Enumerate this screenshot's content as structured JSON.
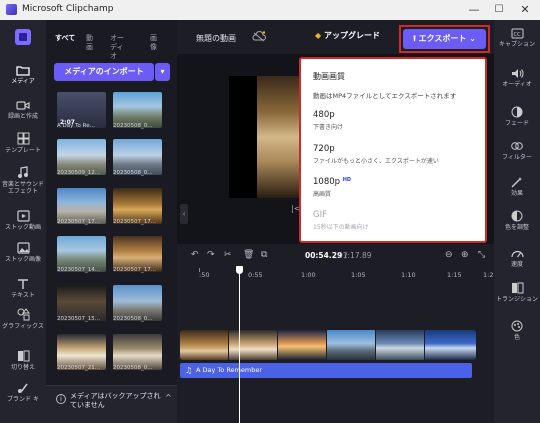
{
  "window": {
    "title": "Microsoft Clipchamp",
    "minimize": "—",
    "maximize": "☐",
    "close": "✕"
  },
  "left_rail": [
    {
      "label": "メディア",
      "icon": "media-icon",
      "active": true
    },
    {
      "label": "録画と作成",
      "icon": "record-icon"
    },
    {
      "label": "テンプレート",
      "icon": "templates-icon"
    },
    {
      "label": "音楽とサウンドエフェクト",
      "icon": "music-icon"
    },
    {
      "label": "ストック動画",
      "icon": "stock-video-icon"
    },
    {
      "label": "ストック画像",
      "icon": "stock-image-icon"
    },
    {
      "label": "テキスト",
      "icon": "text-icon"
    },
    {
      "label": "グラフィックス",
      "icon": "graphics-icon"
    },
    {
      "label": "切り替え",
      "icon": "transitions-icon"
    },
    {
      "label": "ブランド キ",
      "icon": "brand-kit-icon"
    }
  ],
  "media_tabs": [
    "すべて",
    "動画",
    "オーディオ",
    "画像"
  ],
  "import_label": "メディアのインポート",
  "media_items": [
    {
      "label": "A Day To Re...",
      "duration": "2:07"
    },
    {
      "label": "20230508_0..."
    },
    {
      "label": "20230509_12..."
    },
    {
      "label": "20230508_0..."
    },
    {
      "label": "20230507_17..."
    },
    {
      "label": "20230507_17..."
    },
    {
      "label": "20230507_14..."
    },
    {
      "label": "20230507_17..."
    },
    {
      "label": "20230507_15..."
    },
    {
      "label": "20230508_0..."
    },
    {
      "label": "20230507_21..."
    },
    {
      "label": "20230508_0..."
    }
  ],
  "backup_notice": "メディアはバックアップされていません",
  "project_title": "無題の動画",
  "upgrade_label": "アップグレード",
  "export_label": "エクスポート",
  "export_panel": {
    "heading": "動画画質",
    "description": "動画はMP4ファイルとしてエクスポートされます",
    "options": [
      {
        "name": "480p",
        "sub": "下書き向け"
      },
      {
        "name": "720p",
        "sub": "ファイルがもっと小さく、エクスポートが速い"
      },
      {
        "name": "1080p",
        "sub": "高画質",
        "badge": "HD"
      },
      {
        "name": "GIF",
        "sub": "15秒以下の動画向け",
        "disabled": true
      }
    ]
  },
  "time": {
    "current": "00:54.29",
    "separator": "/",
    "total": "01:17.89"
  },
  "ruler": [
    ":50",
    "0:55",
    "1:00",
    "1:05",
    "1:10",
    "1:15",
    "1:2"
  ],
  "audio_track": "A Day To Remember",
  "right_rail": [
    {
      "label": "キャプション",
      "icon": "captions-icon"
    },
    {
      "label": "オーディオ",
      "icon": "audio-icon"
    },
    {
      "label": "フェード",
      "icon": "fade-icon"
    },
    {
      "label": "フィルター",
      "icon": "filter-icon"
    },
    {
      "label": "効果",
      "icon": "effects-icon"
    },
    {
      "label": "色を調整",
      "icon": "color-adjust-icon"
    },
    {
      "label": "速度",
      "icon": "speed-icon"
    },
    {
      "label": "トランジション",
      "icon": "transition-icon"
    },
    {
      "label": "色",
      "icon": "color-icon"
    }
  ],
  "colors": {
    "accent": "#6a5cf5",
    "highlight": "#d12a2a",
    "audio": "#4b62e6"
  }
}
